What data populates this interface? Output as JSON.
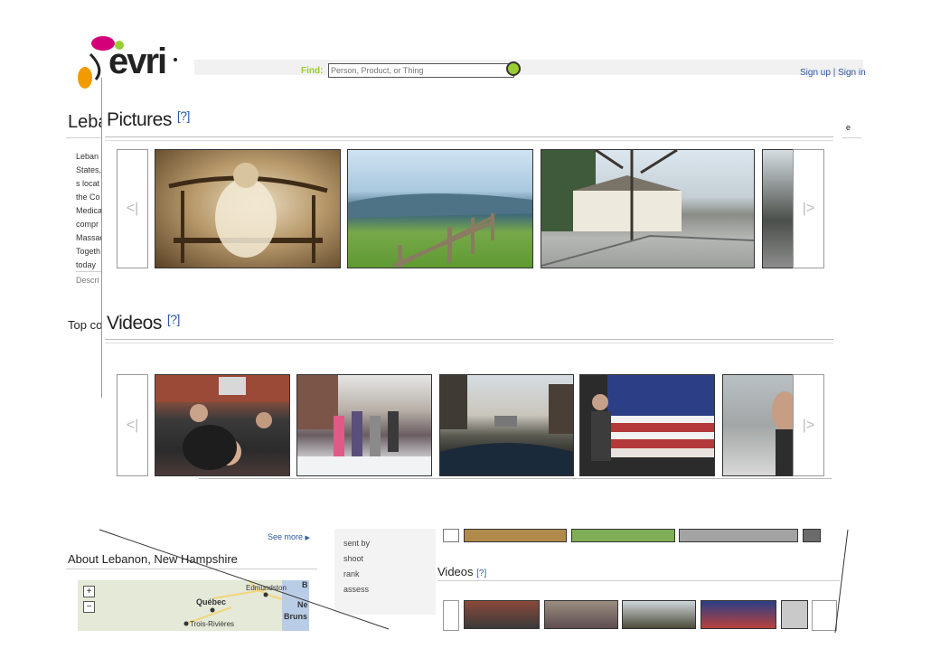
{
  "header": {
    "logo_text": "evri",
    "find_label": "Find:",
    "search_placeholder": "Person, Product, or Thing",
    "signup_text": "Sign up | Sign in"
  },
  "background_page": {
    "title_fragment": "Leba",
    "desc_lines": [
      "Leban",
      "States,",
      "s locat",
      "the Co",
      "Medica",
      "compr",
      "Massac",
      "Togeth",
      "today"
    ],
    "description_label": "Descri",
    "top_fragment": "Top co",
    "see_more": "See more",
    "about_title": "About Lebanon, New Hampshire",
    "filter_items": [
      "sent by",
      "shoot",
      "rank",
      "assess"
    ],
    "bottom_videos_title": "Videos",
    "bottom_videos_help": "[?]",
    "map": {
      "zoom_in": "+",
      "zoom_out": "−",
      "labels": [
        "Edmundston",
        "Québec",
        "Ne",
        "Bruns",
        "Trois-Rivières",
        "B"
      ]
    }
  },
  "pictures": {
    "title": "Pictures",
    "help": "[?]",
    "prev": "<|",
    "next": "|>"
  },
  "videos": {
    "title": "Videos",
    "help": "[?]",
    "prev": "<|",
    "next": "|>"
  },
  "colors": {
    "accent_green": "#9acd32",
    "link_blue": "#2b57a6",
    "logo_magenta": "#d3007a",
    "logo_orange": "#f29b00"
  }
}
